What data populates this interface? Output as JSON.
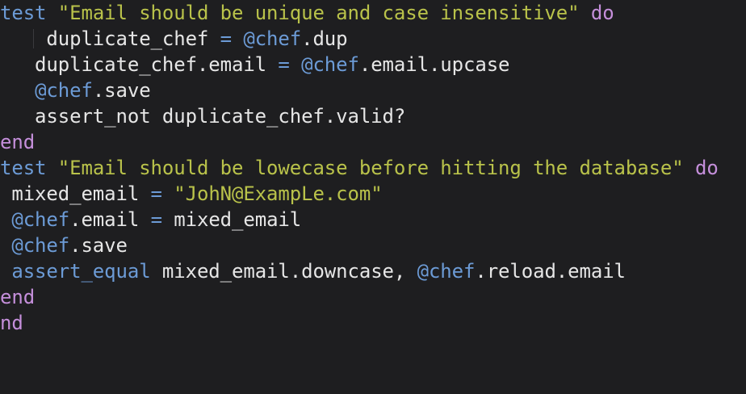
{
  "theme": {
    "background": "#1e1e20",
    "colors": {
      "plain": "#e6e6e6",
      "keyword": "#6c9bd6",
      "string": "#b9c24a",
      "ivar": "#6c9bd6",
      "operator": "#6c9bd6",
      "end": "#c58fdb"
    }
  },
  "editor": {
    "lines": [
      {
        "tokens": [
          {
            "t": "test",
            "c": "keyword"
          },
          {
            "t": " ",
            "c": "plain"
          },
          {
            "t": "\"Email should be unique and case insensitive\"",
            "c": "string"
          },
          {
            "t": " ",
            "c": "plain"
          },
          {
            "t": "do",
            "c": "end"
          }
        ]
      },
      {
        "tokens": [
          {
            "t": "    duplicate_chef ",
            "c": "plain"
          },
          {
            "t": "=",
            "c": "operator"
          },
          {
            "t": " ",
            "c": "plain"
          },
          {
            "t": "@chef",
            "c": "ivar"
          },
          {
            "t": ".dup",
            "c": "plain"
          }
        ]
      },
      {
        "tokens": [
          {
            "t": "   duplicate_chef.email ",
            "c": "plain"
          },
          {
            "t": "=",
            "c": "operator"
          },
          {
            "t": " ",
            "c": "plain"
          },
          {
            "t": "@chef",
            "c": "ivar"
          },
          {
            "t": ".email.upcase",
            "c": "plain"
          }
        ]
      },
      {
        "tokens": [
          {
            "t": "   ",
            "c": "plain"
          },
          {
            "t": "@chef",
            "c": "ivar"
          },
          {
            "t": ".save",
            "c": "plain"
          }
        ]
      },
      {
        "tokens": [
          {
            "t": "   assert_not duplicate_chef.valid?",
            "c": "plain"
          }
        ]
      },
      {
        "tokens": [
          {
            "t": "end",
            "c": "end"
          }
        ]
      },
      {
        "tokens": [
          {
            "t": "test",
            "c": "keyword"
          },
          {
            "t": " ",
            "c": "plain"
          },
          {
            "t": "\"Email should be lowecase before hitting the database\"",
            "c": "string"
          },
          {
            "t": " ",
            "c": "plain"
          },
          {
            "t": "do",
            "c": "end"
          }
        ]
      },
      {
        "tokens": [
          {
            "t": " mixed_email ",
            "c": "plain"
          },
          {
            "t": "=",
            "c": "operator"
          },
          {
            "t": " ",
            "c": "plain"
          },
          {
            "t": "\"JohN@ExampLe.com\"",
            "c": "string"
          }
        ]
      },
      {
        "tokens": [
          {
            "t": " ",
            "c": "plain"
          },
          {
            "t": "@chef",
            "c": "ivar"
          },
          {
            "t": ".email ",
            "c": "plain"
          },
          {
            "t": "=",
            "c": "operator"
          },
          {
            "t": " mixed_email",
            "c": "plain"
          }
        ]
      },
      {
        "tokens": [
          {
            "t": " ",
            "c": "plain"
          },
          {
            "t": "@chef",
            "c": "ivar"
          },
          {
            "t": ".save",
            "c": "plain"
          }
        ]
      },
      {
        "tokens": [
          {
            "t": " ",
            "c": "plain"
          },
          {
            "t": "assert_equal",
            "c": "keyword"
          },
          {
            "t": " mixed_email.downcase, ",
            "c": "plain"
          },
          {
            "t": "@chef",
            "c": "ivar"
          },
          {
            "t": ".reload.email",
            "c": "plain"
          }
        ]
      },
      {
        "tokens": [
          {
            "t": "end",
            "c": "end"
          }
        ]
      },
      {
        "tokens": [
          {
            "t": "nd",
            "c": "end"
          }
        ]
      }
    ]
  }
}
